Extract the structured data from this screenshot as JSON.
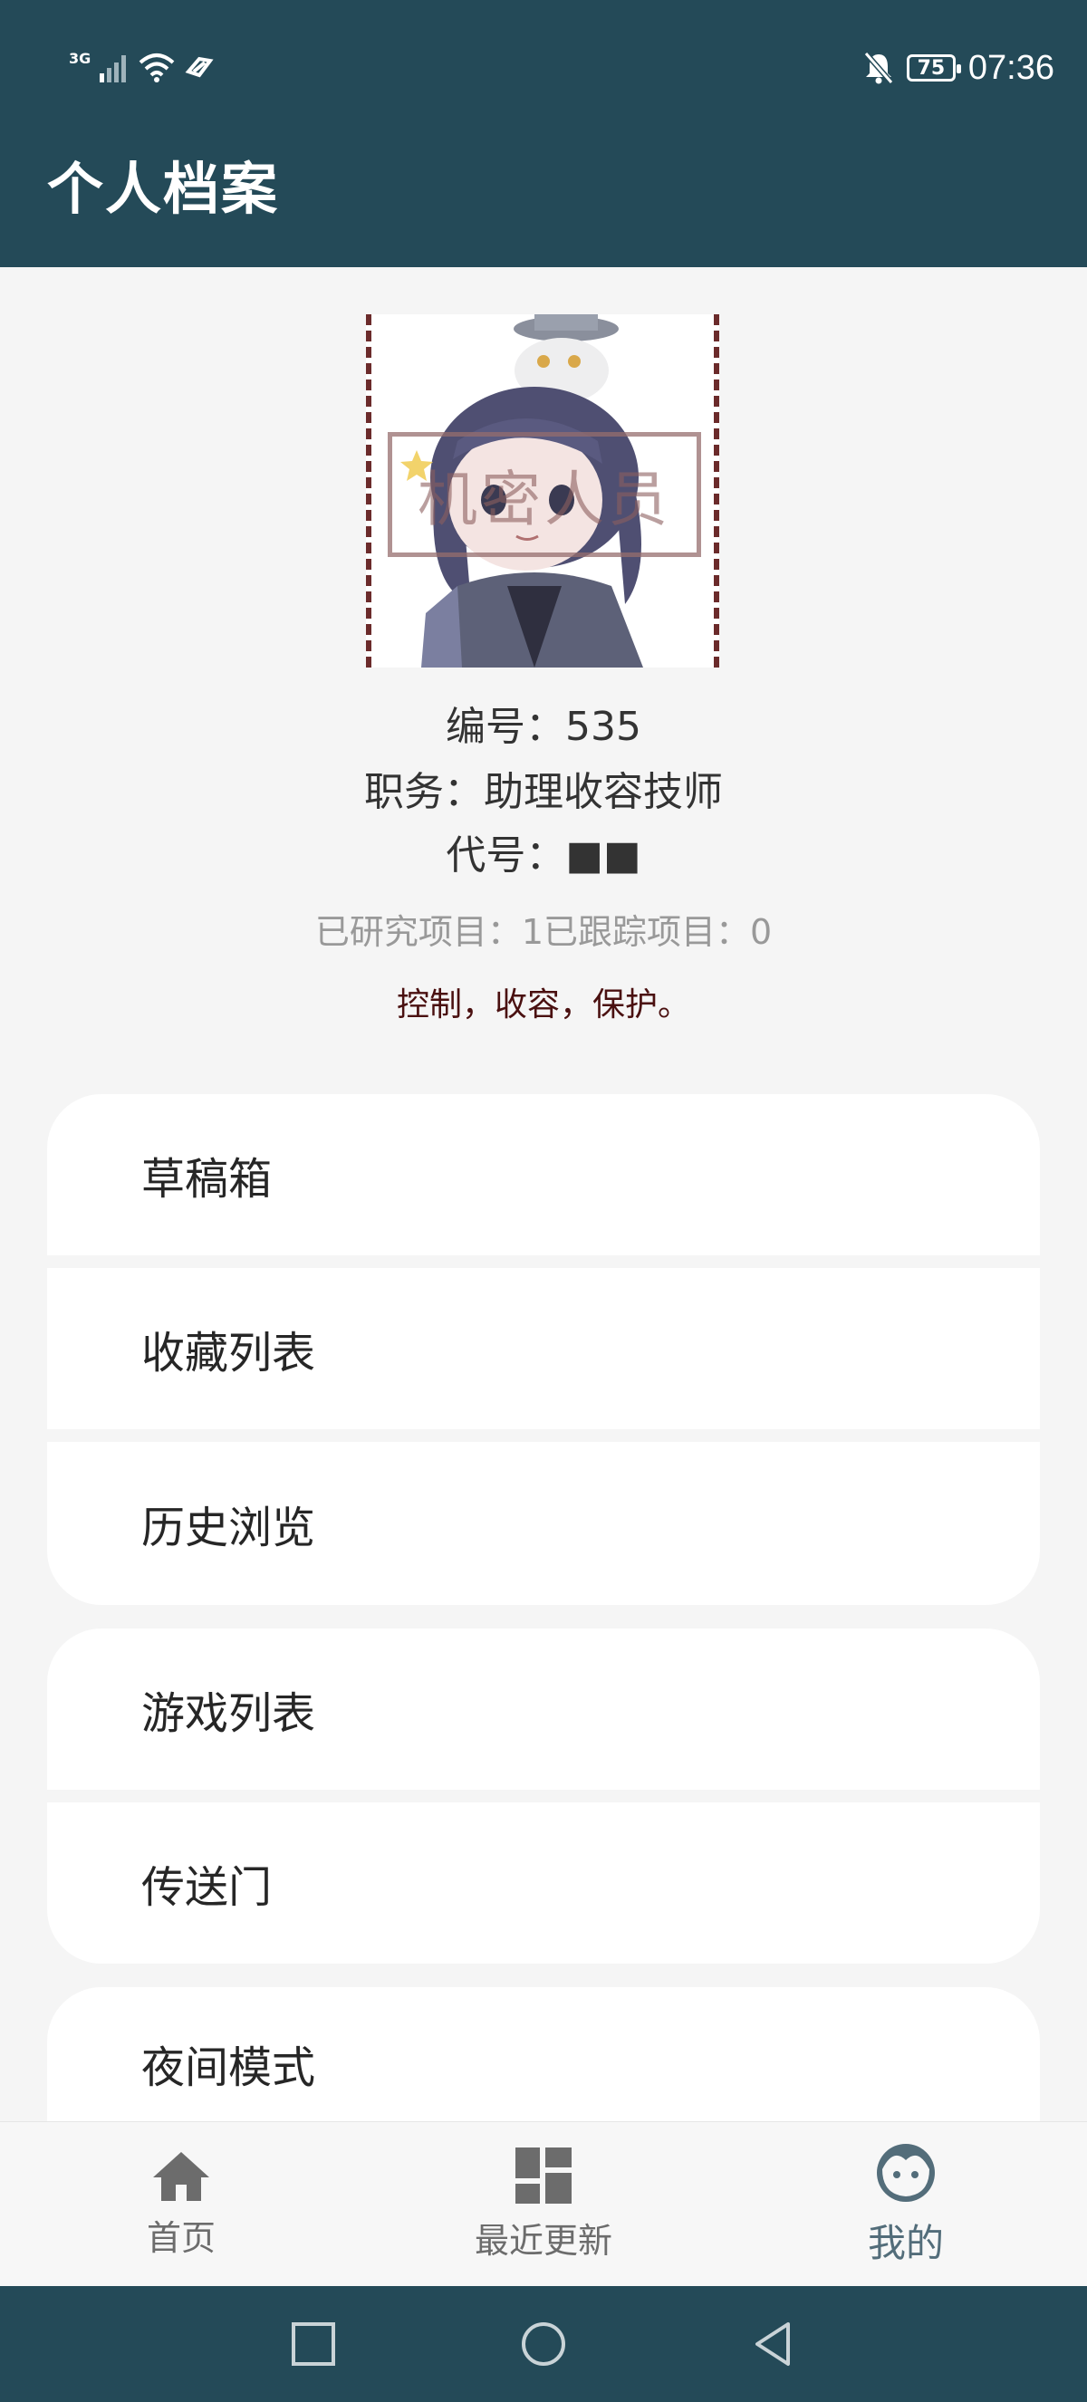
{
  "status_bar": {
    "network": "3G",
    "battery": "75",
    "time": "07:36"
  },
  "app_bar": {
    "title": "个人档案"
  },
  "profile": {
    "stamp_text": "机密人员",
    "id_line": "编号：535",
    "role_line": "职务：助理收容技师",
    "codename_line": "代号：■■",
    "stats_line": "已研究项目：1已跟踪项目：0",
    "motto": "控制，收容，保护。"
  },
  "menu": {
    "group1": [
      "草稿箱",
      "收藏列表",
      "历史浏览"
    ],
    "group2": [
      "游戏列表",
      "传送门"
    ],
    "group3": [
      "夜间模式"
    ]
  },
  "bottom_nav": {
    "items": [
      {
        "label": "首页",
        "icon": "home-icon"
      },
      {
        "label": "最近更新",
        "icon": "dashboard-icon"
      },
      {
        "label": "我的",
        "icon": "face-icon"
      }
    ],
    "active": "我的"
  },
  "colors": {
    "primary": "#244a58",
    "accent_text": "#4a1010",
    "active_nav": "#536d7a"
  }
}
